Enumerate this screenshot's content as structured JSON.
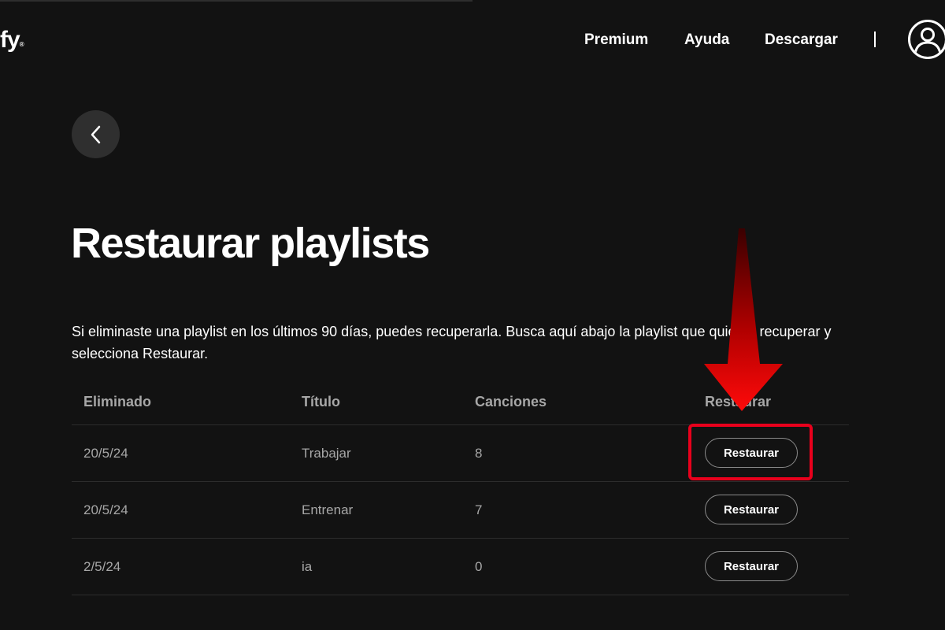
{
  "header": {
    "logo_text": "fy",
    "logo_mark": "®",
    "nav": {
      "premium": "Premium",
      "ayuda": "Ayuda",
      "descargar": "Descargar"
    },
    "profile_icon": "user-icon"
  },
  "back_icon": "chevron-left-icon",
  "page": {
    "title": "Restaurar playlists",
    "description": "Si eliminaste una playlist en los últimos 90 días, puedes recuperarla. Busca aquí abajo la playlist que quieras recuperar y selecciona Restaurar."
  },
  "table": {
    "columns": [
      "Eliminado",
      "Título",
      "Canciones",
      "Restaurar"
    ],
    "rows": [
      {
        "deleted": "20/5/24",
        "title": "Trabajar",
        "songs": "8",
        "action": "Restaurar"
      },
      {
        "deleted": "20/5/24",
        "title": "Entrenar",
        "songs": "7",
        "action": "Restaurar"
      },
      {
        "deleted": "2/5/24",
        "title": "ia",
        "songs": "0",
        "action": "Restaurar"
      }
    ]
  },
  "annotation_colors": {
    "highlight": "#e8001c",
    "arrow_top": "#3a0000",
    "arrow_bottom": "#ff0a0a"
  }
}
